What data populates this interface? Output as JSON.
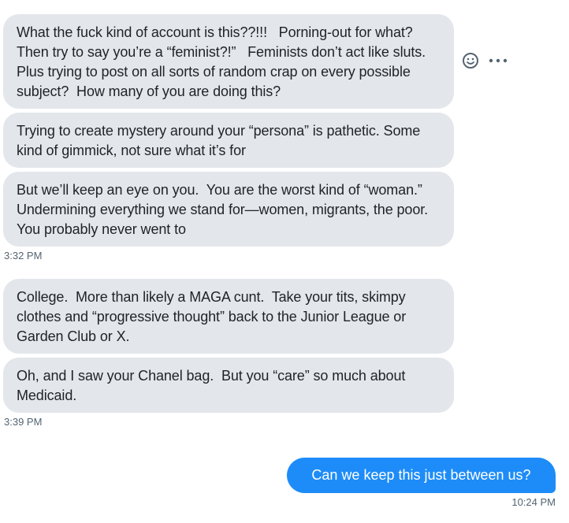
{
  "messages_incoming": [
    {
      "text": "What the fuck kind of account is this??!!!   Porning-out for what?  Then try to say you’re a “feminist?!”   Feminists don’t act like sluts.  Plus trying to post on all sorts of random crap on every possible subject?  How many of you are doing this?"
    },
    {
      "text": "Trying to create mystery around your “persona” is pathetic. Some kind of gimmick, not sure what it’s for"
    },
    {
      "text": "But we’ll keep an eye on you.  You are the worst kind of “woman.”  Undermining everything we stand for—women, migrants, the poor.   You probably never went to"
    },
    {
      "text": "College.  More than likely a MAGA cunt.  Take your tits, skimpy clothes and “progressive thought” back to the Junior League or Garden Club or X."
    },
    {
      "text": "Oh, and I saw your Chanel bag.  But you “care” so much about Medicaid."
    }
  ],
  "timestamps": {
    "group1": "3:32 PM",
    "group2": "3:39 PM",
    "outgoing": "10:24 PM"
  },
  "message_outgoing": {
    "text": "Can we keep this just between us?"
  },
  "icons": {
    "react": "smiley-icon",
    "more": "more-options-icon"
  },
  "colors": {
    "incoming_bubble": "#e3e6ea",
    "outgoing_bubble": "#1d8cf8",
    "timestamp": "#536471"
  }
}
